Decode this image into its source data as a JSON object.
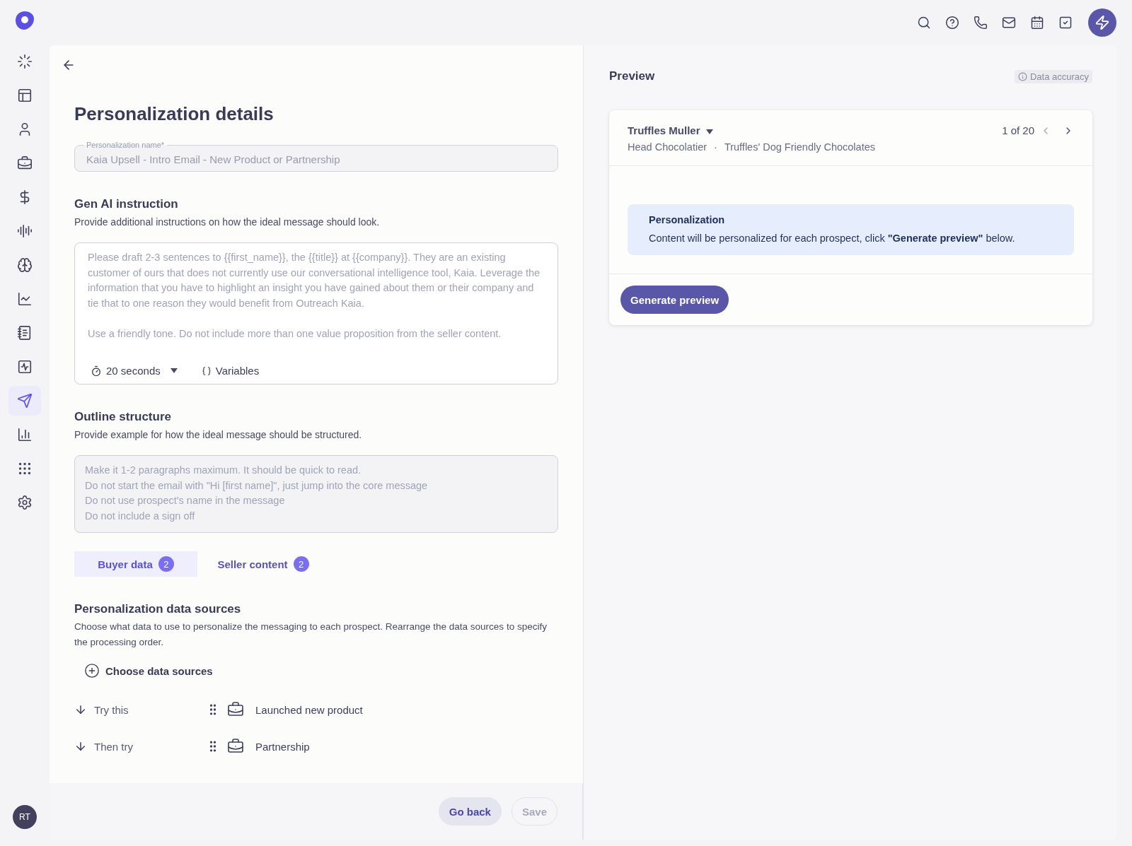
{
  "sidebar": {
    "items": [
      {
        "selected": false
      },
      {
        "selected": false
      },
      {
        "selected": false
      },
      {
        "selected": false
      },
      {
        "selected": false
      },
      {
        "selected": false
      },
      {
        "selected": false
      },
      {
        "selected": false
      },
      {
        "selected": false
      },
      {
        "selected": false
      },
      {
        "selected": true
      },
      {
        "selected": false
      },
      {
        "selected": false
      },
      {
        "selected": false
      }
    ],
    "avatar": "RT"
  },
  "title": "Personalization details",
  "name_field": {
    "label": "Personalization name*",
    "value": "Kaia Upsell - Intro Email - New Product or Partnership",
    "disabled": true
  },
  "gen_ai": {
    "heading": "Gen AI instruction",
    "description": "Provide additional instructions on how the ideal message should look.",
    "placeholder": "Please draft 2-3 sentences to {{first_name}}, the {{title}} at {{company}}. They are an existing customer of ours that does not currently use our conversational intelligence tool, Kaia. Leverage the information that you have to highlight an insight you have gained about them or their company and tie that to one reason they would benefit from Outreach Kaia.\n\nUse a friendly tone. Do not include more than one value proposition from the seller content.",
    "duration": "20 seconds",
    "variables": "Variables"
  },
  "outline": {
    "heading": "Outline structure",
    "description": "Provide example for how the ideal message should be structured.",
    "placeholder": "Make it 1-2 paragraphs maximum. It should be quick to read.\nDo not start the email with \"Hi [first name]\", just jump into the core message\nDo not use prospect's name in the message\nDo not include a sign off",
    "disabled": true
  },
  "tabs": [
    {
      "label": "Buyer data",
      "count": "2",
      "selected": true
    },
    {
      "label": "Seller content",
      "count": "2",
      "selected": false
    }
  ],
  "data_sources": {
    "heading": "Personalization data sources",
    "description": "Choose what data to use to personalize the messaging to each prospect. Rearrange the data sources to specify the processing order.",
    "add_label": "Choose data sources",
    "rows": [
      {
        "order": "Try this",
        "name": "Launched new product"
      },
      {
        "order": "Then try",
        "name": "Partnership"
      }
    ]
  },
  "footer": {
    "buttons": [
      {
        "label": "Go back",
        "disabled": false
      },
      {
        "label": "Save",
        "disabled": true
      }
    ]
  },
  "preview": {
    "heading": "Preview",
    "accuracy": "Data accuracy",
    "prospect": {
      "name": "Truffles Muller",
      "title": "Head Chocolatier",
      "separator": "·",
      "company": "Truffles' Dog Friendly Chocolates"
    },
    "pager": "1 of 20",
    "notice": {
      "title": "Personalization",
      "text": "Content will be personalized for each prospect, click **\"Generate preview\"** below."
    },
    "button": "Generate preview"
  }
}
